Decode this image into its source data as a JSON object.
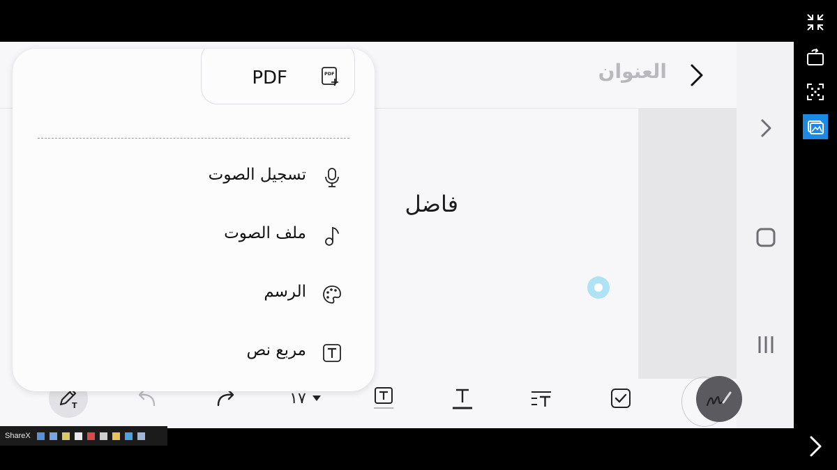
{
  "note": {
    "title_placeholder": "العنوان",
    "body_text": "فاضل"
  },
  "menu": {
    "pdf_label": "PDF",
    "items": [
      {
        "label": "تسجيل الصوت",
        "icon": "microphone-icon"
      },
      {
        "label": "ملف الصوت",
        "icon": "music-note-icon"
      },
      {
        "label": "الرسم",
        "icon": "palette-icon"
      },
      {
        "label": "مربع نص",
        "icon": "text-box-icon"
      }
    ]
  },
  "toolbar": {
    "font_size": "١٧"
  },
  "sharex": {
    "label": "ShareX"
  },
  "colors": {
    "accent_blue": "#1e88e5",
    "cursor_blue": "#aee3f5",
    "fab_gray": "#5b5b5f"
  }
}
